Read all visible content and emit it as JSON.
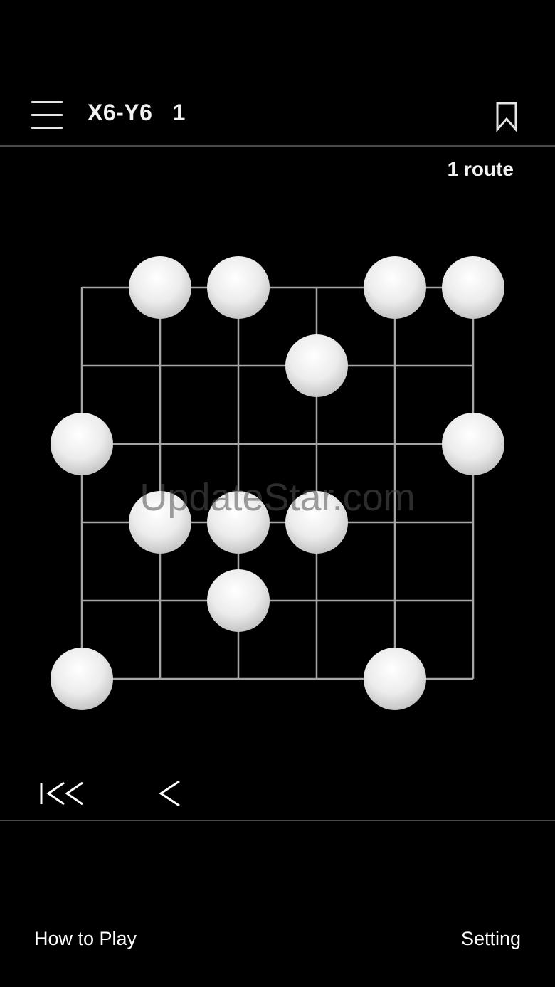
{
  "header": {
    "title": "X6-Y6   1",
    "menu_icon": "hamburger-menu-icon",
    "bookmark_icon": "bookmark-icon"
  },
  "route_count": "1 route",
  "board": {
    "grid_size": 6,
    "line_color": "#a6a6a6",
    "stone_color": "#e0e0e0",
    "stones": [
      {
        "col": 1,
        "row": 0
      },
      {
        "col": 2,
        "row": 0
      },
      {
        "col": 4,
        "row": 0
      },
      {
        "col": 5,
        "row": 0
      },
      {
        "col": 3,
        "row": 1
      },
      {
        "col": 0,
        "row": 2
      },
      {
        "col": 5,
        "row": 2
      },
      {
        "col": 1,
        "row": 3
      },
      {
        "col": 2,
        "row": 3
      },
      {
        "col": 3,
        "row": 3
      },
      {
        "col": 2,
        "row": 4
      },
      {
        "col": 0,
        "row": 5
      },
      {
        "col": 4,
        "row": 5
      }
    ]
  },
  "watermark": "UpdateStar.com",
  "controls": {
    "first_icon": "first-move-icon",
    "back_icon": "previous-move-icon"
  },
  "footer": {
    "how_to_play": "How to Play",
    "setting": "Setting"
  }
}
